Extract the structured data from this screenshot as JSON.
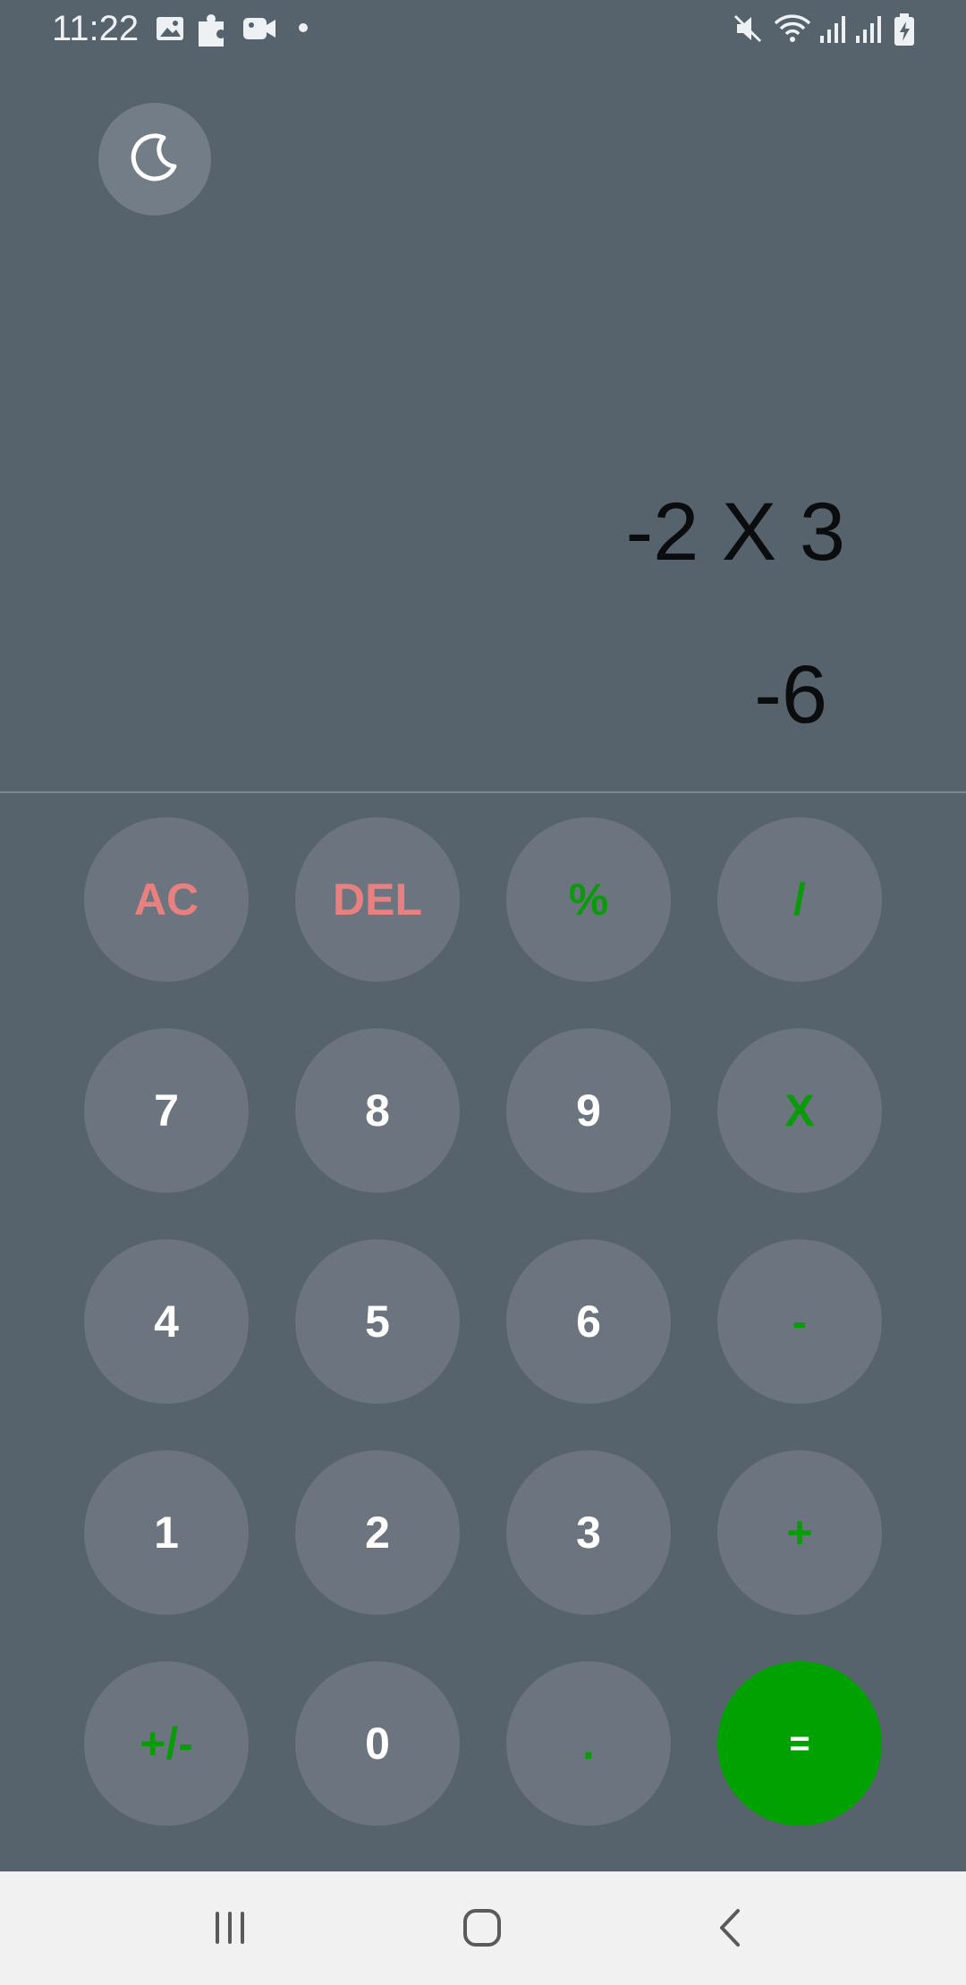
{
  "status_bar": {
    "time": "11:22",
    "icons_left": [
      "image-icon",
      "puzzle-icon",
      "video-icon",
      "dot-icon"
    ],
    "icons_right": [
      "mute-icon",
      "wifi-icon",
      "signal-icon",
      "signal-icon",
      "battery-charging-icon"
    ]
  },
  "theme_toggle": {
    "icon": "moon-icon"
  },
  "display": {
    "expression": "-2 X 3",
    "result": "-6"
  },
  "keypad": {
    "rows": [
      [
        {
          "label": "AC",
          "kind": "fn"
        },
        {
          "label": "DEL",
          "kind": "fn"
        },
        {
          "label": "%",
          "kind": "op"
        },
        {
          "label": "/",
          "kind": "op"
        }
      ],
      [
        {
          "label": "7",
          "kind": "num"
        },
        {
          "label": "8",
          "kind": "num"
        },
        {
          "label": "9",
          "kind": "num"
        },
        {
          "label": "X",
          "kind": "op"
        }
      ],
      [
        {
          "label": "4",
          "kind": "num"
        },
        {
          "label": "5",
          "kind": "num"
        },
        {
          "label": "6",
          "kind": "num"
        },
        {
          "label": "-",
          "kind": "op"
        }
      ],
      [
        {
          "label": "1",
          "kind": "num"
        },
        {
          "label": "2",
          "kind": "num"
        },
        {
          "label": "3",
          "kind": "num"
        },
        {
          "label": "+",
          "kind": "op"
        }
      ],
      [
        {
          "label": "+/-",
          "kind": "op"
        },
        {
          "label": "0",
          "kind": "num"
        },
        {
          "label": ".",
          "kind": "op"
        },
        {
          "label": "=",
          "kind": "eq"
        }
      ]
    ]
  },
  "colors": {
    "background": "#56626c",
    "key": "#6c757f",
    "function_text": "#e98080",
    "operator_text": "#0a9a0a",
    "equals": "#01a102"
  },
  "nav_bar": {
    "buttons": [
      "recents-icon",
      "home-icon",
      "back-icon"
    ]
  }
}
